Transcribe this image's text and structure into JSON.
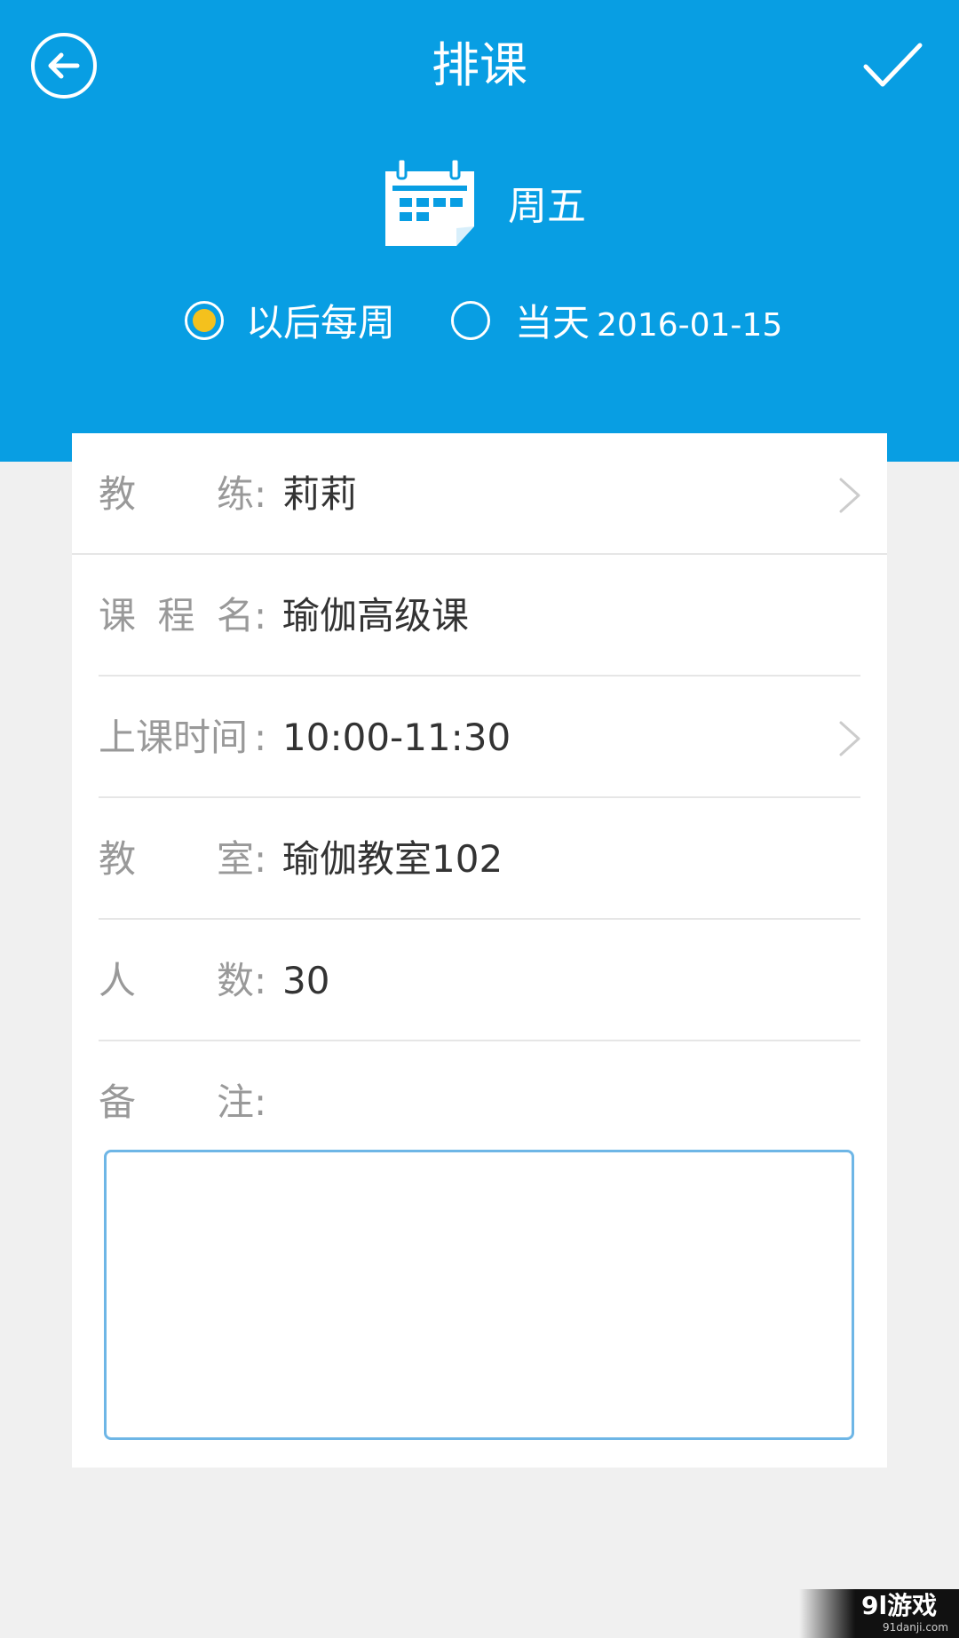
{
  "header": {
    "title": "排课",
    "day": "周五",
    "bg_color": "#089ee3",
    "back_icon": "back-arrow-icon",
    "confirm_icon": "check-icon",
    "calendar_icon": "calendar-icon"
  },
  "repeat_options": [
    {
      "label": "以后每周",
      "selected": true
    },
    {
      "label": "当天",
      "date": "2016-01-15",
      "selected": false
    }
  ],
  "form": {
    "coach": {
      "label_chars": [
        "教",
        "练"
      ],
      "colon": ":",
      "value": "莉莉",
      "has_chevron": true
    },
    "course": {
      "label_chars": [
        "课",
        "程",
        "名"
      ],
      "colon": ":",
      "value": "瑜伽高级课"
    },
    "time": {
      "label_chars": [
        "上课时间"
      ],
      "colon": ":",
      "value": "10:00-11:30",
      "has_chevron": true
    },
    "classroom": {
      "label_chars": [
        "教",
        "室"
      ],
      "colon": ":",
      "value": "瑜伽教室102"
    },
    "capacity": {
      "label_chars": [
        "人",
        "数"
      ],
      "colon": ":",
      "value": "30"
    },
    "remark": {
      "label_chars": [
        "备",
        "注"
      ],
      "colon": ":",
      "value": ""
    }
  },
  "watermark": {
    "logo": "9l游戏",
    "url": "91danji.com"
  },
  "colors": {
    "accent": "#089ee3",
    "radio_selected": "#f4c11d",
    "label": "#999999",
    "value": "#333333",
    "remark_border": "#6eb6e6"
  }
}
